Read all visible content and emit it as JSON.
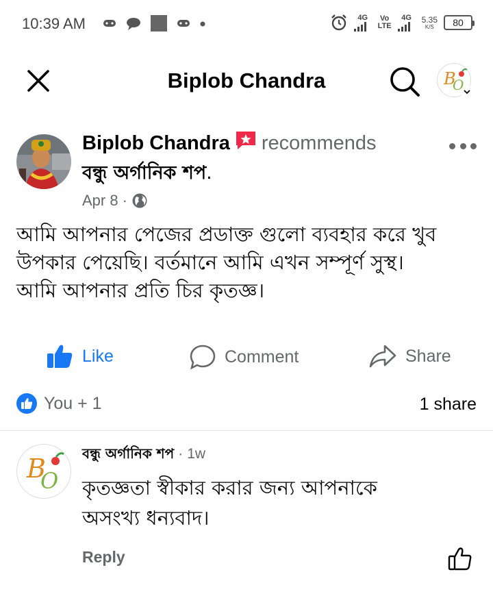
{
  "status_bar": {
    "time": "10:39 AM",
    "net1": "4G",
    "net2_top": "Vo",
    "net2_bottom": "LTE",
    "net3": "4G",
    "speed_value": "5.35",
    "speed_unit": "K/S",
    "battery": "80"
  },
  "header": {
    "title": "Biplob Chandra",
    "close_icon": "close-icon",
    "search_icon": "search-icon"
  },
  "post": {
    "author": "Biplob Chandra",
    "action": "recommends",
    "page_name": "বন্ধু অর্গানিক শপ",
    "page_suffix": ".",
    "date": "Apr 8",
    "separator": "·",
    "body_lines": [
      "আমি আপনার পেজের প্রডাক্ত গুলো ব্যবহার করে খুব",
      "উপকার পেয়েছি। বর্তমানে আমি এখন সম্পূর্ণ সুস্থ।",
      "আমি আপনার প্রতি চির কৃতজ্ঞ।"
    ]
  },
  "actions": {
    "like": "Like",
    "comment": "Comment",
    "share": "Share"
  },
  "reactions": {
    "summary": "You + 1",
    "shares": "1 share"
  },
  "comment": {
    "author": "বন্ধু অর্গানিক শপ",
    "separator": "·",
    "time": "1w",
    "text_lines": [
      "কৃতজ্ঞতা স্বীকার করার জন্য আপনাকে",
      "অসংখ্য ধন্যবাদ।"
    ],
    "reply": "Reply"
  },
  "colors": {
    "accent": "#1877f2",
    "muted": "#65676b",
    "badge": "#f02849"
  }
}
